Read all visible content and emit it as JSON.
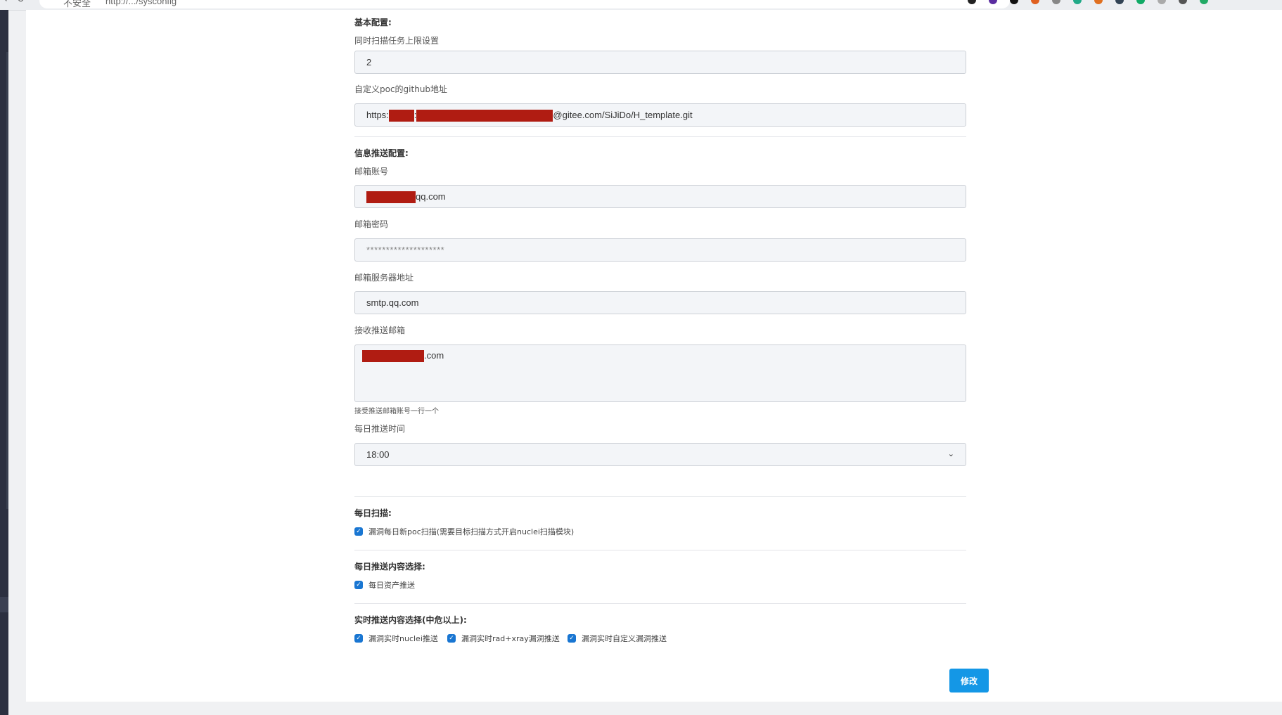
{
  "browser": {
    "url": "http://.../sysconfig",
    "security_label": "不安全"
  },
  "basic": {
    "title": "基本配置:",
    "task_limit_label": "同时扫描任务上限设置",
    "task_limit_value": "2",
    "poc_github_label": "自定义poc的github地址",
    "poc_github_prefix": "https:",
    "poc_github_sep": ":",
    "poc_github_suffix": "@gitee.com/SiJiDo/H_template.git"
  },
  "notify": {
    "title": "信息推送配置:",
    "email_account_label": "邮箱账号",
    "email_account_suffix": "qq.com",
    "email_password_label": "邮箱密码",
    "email_password_value": "********************",
    "smtp_label": "邮箱服务器地址",
    "smtp_value": "smtp.qq.com",
    "receivers_label": "接收推送邮箱",
    "receivers_suffix": ".com",
    "receivers_hint": "接受推送邮箱账号一行一个",
    "push_time_label": "每日推送时间",
    "push_time_value": "18:00"
  },
  "daily_scan": {
    "title": "每日扫描:",
    "options": [
      {
        "label": "漏洞每日新poc扫描(需要目标扫描方式开启nuclei扫描模块)",
        "checked": true
      }
    ]
  },
  "daily_push": {
    "title": "每日推送内容选择:",
    "options": [
      {
        "label": "每日资产推送",
        "checked": true
      }
    ]
  },
  "realtime_push": {
    "title": "实时推送内容选择(中危以上):",
    "options": [
      {
        "label": "漏洞实时nuclei推送",
        "checked": true
      },
      {
        "label": "漏洞实时rad+xray漏洞推送",
        "checked": true
      },
      {
        "label": "漏洞实时自定义漏洞推送",
        "checked": true
      }
    ]
  },
  "submit_label": "修改",
  "colors": {
    "accent": "#1497e6",
    "checkbox": "#1976d2",
    "redaction": "#b01c12",
    "sidebar": "#2c3040"
  }
}
